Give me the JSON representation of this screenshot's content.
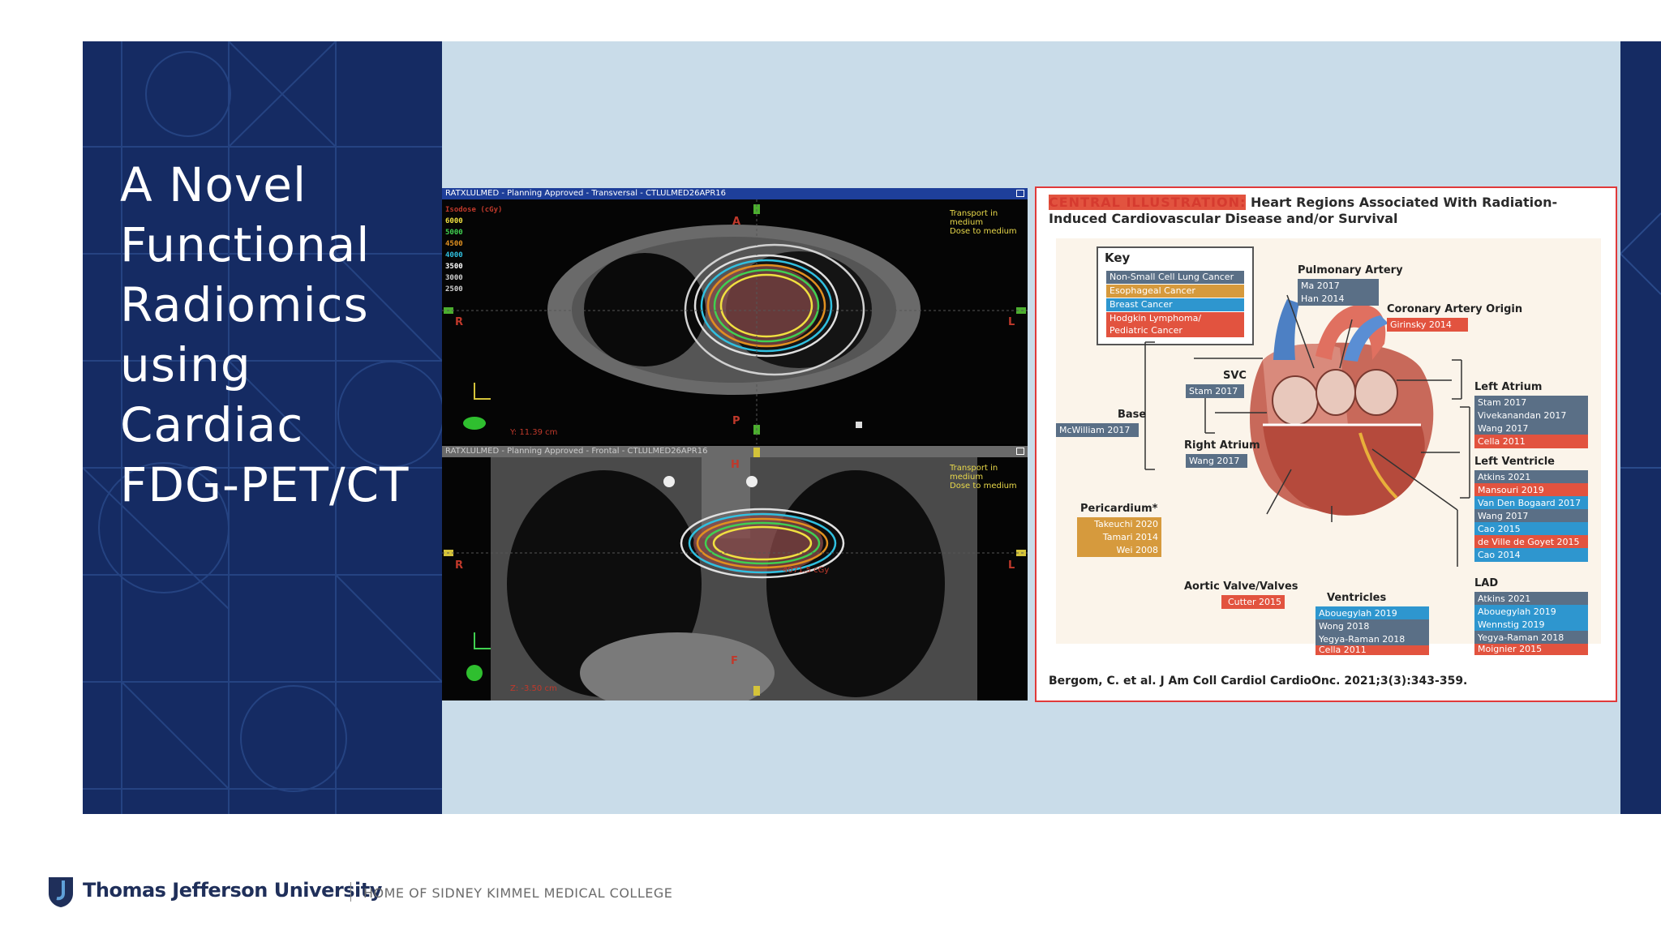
{
  "slide": {
    "title_lines": [
      "A Novel",
      "Functional",
      "Radiomics",
      "using Cardiac",
      "FDG-PET/CT"
    ]
  },
  "ct": {
    "top_bar": "RATXLULMED - Planning Approved - Transversal - CTLULMED26APR16",
    "bottom_bar": "RATXLULMED - Planning Approved - Frontal - CTLULMED26APR16",
    "isodose_title": "Isodose (cGy)",
    "isodose_levels": [
      {
        "label": "6000",
        "color": "#f0e040"
      },
      {
        "label": "5000",
        "color": "#40d050"
      },
      {
        "label": "4500",
        "color": "#e09020"
      },
      {
        "label": "4000",
        "color": "#30c0e0"
      },
      {
        "label": "3500",
        "color": "#ffffff"
      },
      {
        "label": "3000",
        "color": "#d0d0d0"
      },
      {
        "label": "2500",
        "color": "#d0d0d0"
      }
    ],
    "transport_lines": [
      "Transport in",
      "medium",
      "Dose to medium"
    ],
    "top_orient": {
      "a": "A",
      "r": "R",
      "l": "L",
      "p": "P"
    },
    "bottom_orient": {
      "h": "H",
      "r": "R",
      "l": "L",
      "f": "F"
    },
    "top_info": "Y: 11.39 cm",
    "bottom_info": "Z: -3.50 cm",
    "bottom_dose": "4071.5 cGy"
  },
  "illustration": {
    "header_red": "CENTRAL ILLUSTRATION:",
    "header_rest": "Heart Regions Associated With Radiation-Induced Cardiovascular Disease and/or Survival",
    "key": {
      "title": "Key",
      "items": [
        {
          "label": "Non-Small Cell Lung Cancer",
          "color": "#5a6f86"
        },
        {
          "label": "Esophageal Cancer",
          "color": "#d69a3d"
        },
        {
          "label": "Breast Cancer",
          "color": "#2e96cf"
        },
        {
          "label": "Hodgkin Lymphoma/",
          "color": "#e2533f"
        },
        {
          "label": "Pediatric Cancer",
          "color": "#e2533f"
        }
      ]
    },
    "regions": {
      "pulmonary_artery": {
        "label": "Pulmonary Artery",
        "refs": [
          "Ma 2017",
          "Han 2014"
        ]
      },
      "coronary_origin": {
        "label": "Coronary Artery Origin",
        "refs": [
          "Girinsky 2014"
        ]
      },
      "svc": {
        "label": "SVC",
        "refs": [
          "Stam 2017"
        ]
      },
      "base": {
        "label": "Base",
        "refs": [
          "McWilliam 2017"
        ]
      },
      "right_atrium": {
        "label": "Right Atrium",
        "refs": [
          "Wang 2017"
        ]
      },
      "pericardium": {
        "label": "Pericardium*",
        "refs": [
          "Takeuchi 2020",
          "Tamari 2014",
          "Wei 2008"
        ]
      },
      "aortic_valve": {
        "label": "Aortic Valve/Valves",
        "refs": [
          "Cutter 2015"
        ]
      },
      "ventricles": {
        "label": "Ventricles",
        "refs": [
          "Abouegylah 2019",
          "Wong 2018",
          "Yegya-Raman 2018",
          "Cella 2011"
        ]
      },
      "left_atrium": {
        "label": "Left Atrium",
        "refs": [
          "Stam 2017",
          "Vivekanandan 2017",
          "Wang 2017",
          "Cella 2011"
        ]
      },
      "left_ventricle": {
        "label": "Left Ventricle",
        "refs": [
          "Atkins 2021",
          "Mansouri 2019",
          "Van Den Bogaard 2017",
          "Wang 2017",
          "Cao 2015",
          "de Ville de Goyet 2015",
          "Cao 2014"
        ]
      },
      "lad": {
        "label": "LAD",
        "refs": [
          "Atkins 2021",
          "Abouegylah 2019",
          "Wennstig 2019",
          "Yegya-Raman 2018",
          "Moignier 2015"
        ]
      }
    },
    "citation": "Bergom, C. et al. J Am Coll Cardiol CardioOnc. 2021;3(3):343-359."
  },
  "footer": {
    "university": "Thomas Jefferson University",
    "tagline": "HOME OF SIDNEY KIMMEL MEDICAL COLLEGE"
  }
}
